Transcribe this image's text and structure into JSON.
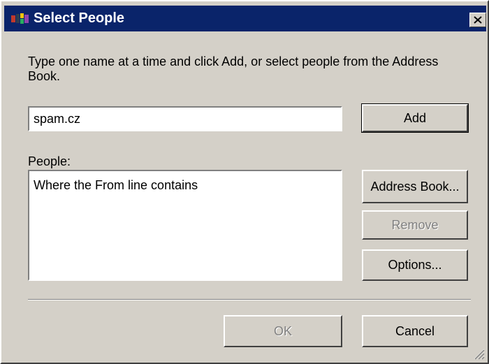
{
  "window": {
    "title": "Select People"
  },
  "instructions": "Type one name at a time and click Add, or select people from the Address Book.",
  "name_input": {
    "value": "spam.cz"
  },
  "people": {
    "label": "People:",
    "items": [
      "Where the From line contains"
    ]
  },
  "buttons": {
    "add": "Add",
    "address_book": "Address Book...",
    "remove": "Remove",
    "options": "Options...",
    "ok": "OK",
    "cancel": "Cancel"
  },
  "colors": {
    "titlebar": "#0a246a",
    "face": "#d4d0c8",
    "disabled_text": "#808080"
  },
  "icons": {
    "title_icon": "address-book-icon",
    "close": "close-icon",
    "resize": "resize-grip-icon"
  }
}
